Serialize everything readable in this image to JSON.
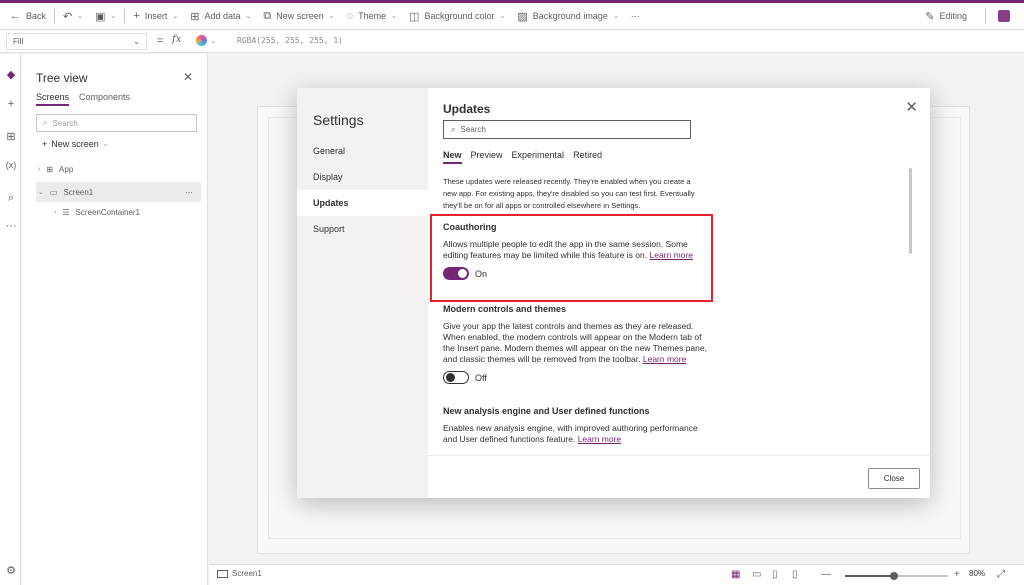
{
  "command_bar": {
    "back": "Back",
    "insert": "Insert",
    "add_data": "Add data",
    "new_screen": "New screen",
    "theme": "Theme",
    "background_color": "Background color",
    "background_image": "Background image",
    "more": "···",
    "editing": "Editing"
  },
  "formula_bar": {
    "property": "Fill",
    "equals": "=",
    "fx": "fx",
    "formula": "RGBA(255, 255, 255, 1)"
  },
  "tree_view": {
    "title": "Tree view",
    "tabs": [
      "Screens",
      "Components"
    ],
    "search_placeholder": "Search",
    "new_screen": "New screen",
    "nodes": [
      "App",
      "Screen1",
      "ScreenContainer1"
    ],
    "node_more": "···"
  },
  "status_bar": {
    "screen": "Screen1",
    "zoom_minus": "—",
    "zoom_plus": "+",
    "zoom": "80%",
    "zoom_fraction": 0.48
  },
  "settings": {
    "title": "Settings",
    "nav": [
      "General",
      "Display",
      "Updates",
      "Support"
    ],
    "active_nav": "Updates",
    "heading": "Updates",
    "search_placeholder": "Search",
    "tabs": [
      "New",
      "Preview",
      "Experimental",
      "Retired"
    ],
    "intro": "These updates were released recently. They're enabled when you create a new app. For existing apps, they're disabled so you can test first. Eventually they'll be on for all apps or controlled elsewhere in Settings.",
    "features": [
      {
        "title": "Coauthoring",
        "desc": "Allows multiple people to edit the app in the same session. Some editing features may be limited while this feature is on.",
        "link": "Learn more",
        "state": "On"
      },
      {
        "title": "Modern controls and themes",
        "desc": "Give your app the latest controls and themes as they are released. When enabled, the modern controls will appear on the Modern tab of the Insert pane. Modern themes will appear on the new Themes pane, and classic themes will be removed from the toolbar.",
        "link": "Learn more",
        "state": "Off"
      },
      {
        "title": "New analysis engine and User defined functions",
        "desc": "Enables new analysis engine, with improved authoring performance and User defined functions feature.",
        "link": "Learn more"
      }
    ],
    "close_label": "Close",
    "accent_color": "#742774",
    "highlight_color": "#e8202a"
  }
}
